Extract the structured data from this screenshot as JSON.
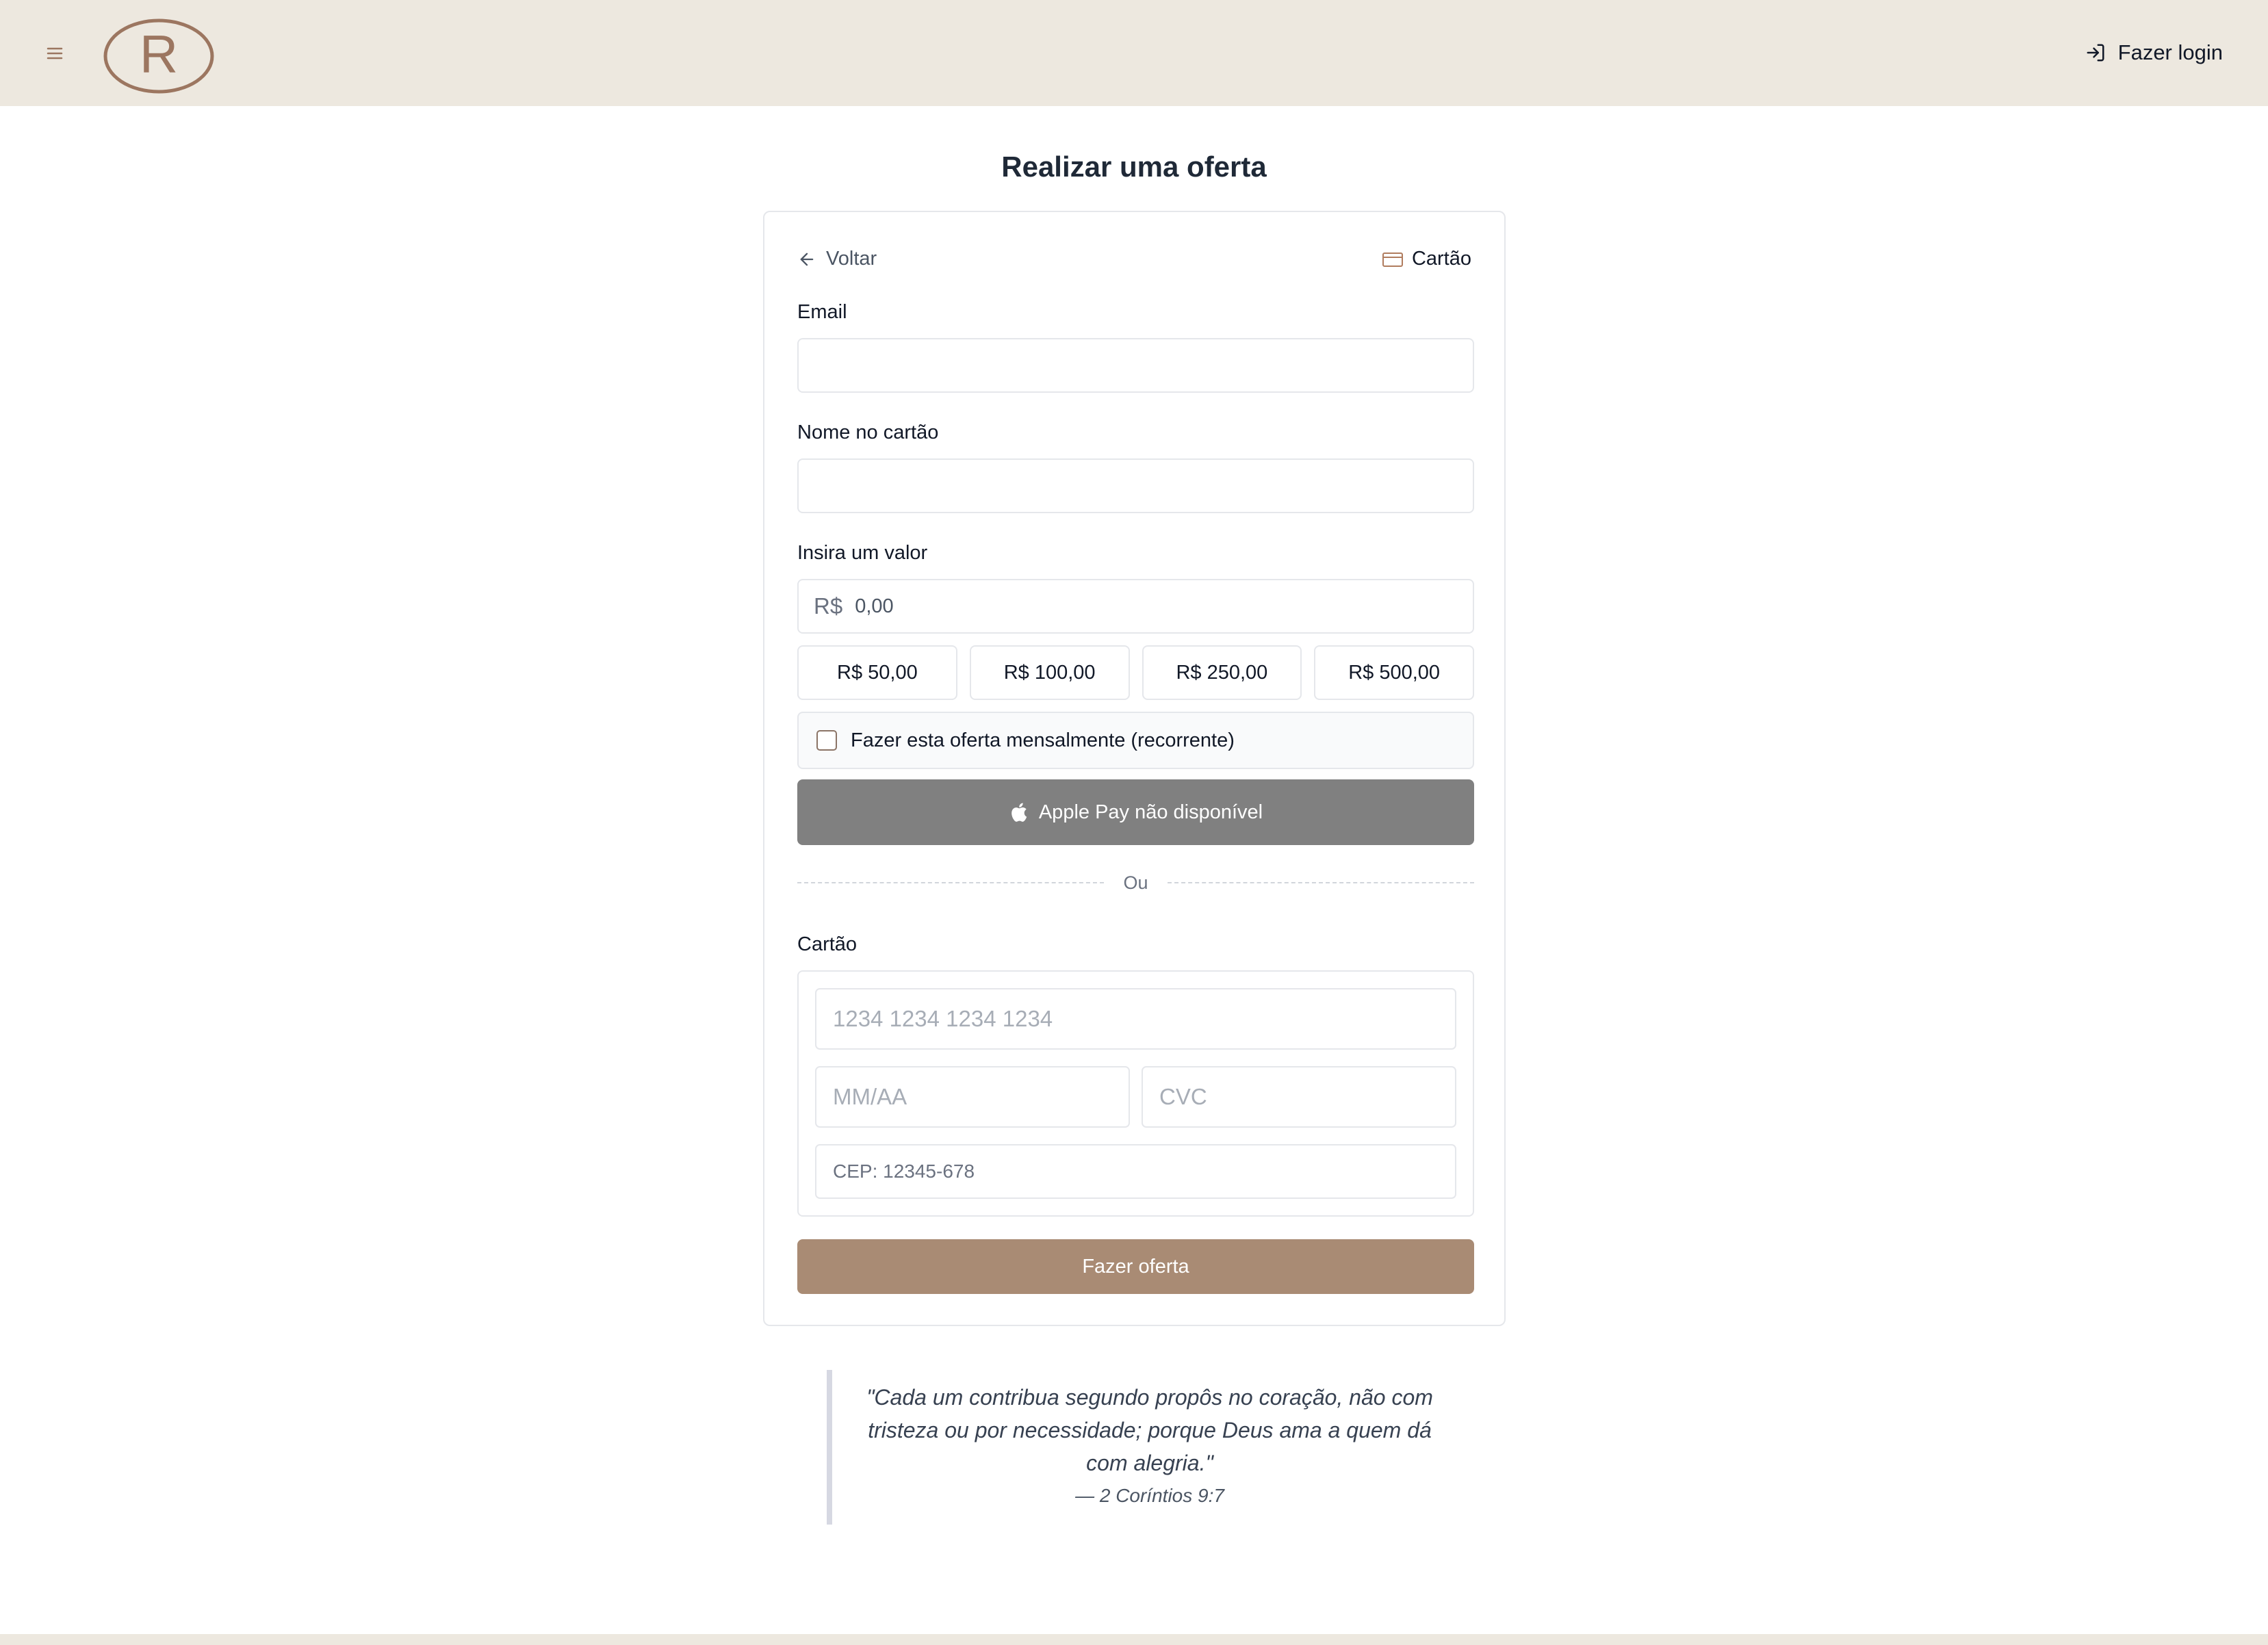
{
  "header": {
    "login_label": "Fazer login"
  },
  "logo": {
    "letter": "R"
  },
  "page_title": "Realizar uma oferta",
  "form": {
    "back_label": "Voltar",
    "method_label": "Cartão",
    "email_label": "Email",
    "email_value": "",
    "name_label": "Nome no cartão",
    "name_value": "",
    "amount_label": "Insira um valor",
    "amount_prefix": "R$",
    "amount_placeholder": "0,00",
    "presets": [
      "R$ 50,00",
      "R$ 100,00",
      "R$ 250,00",
      "R$ 500,00"
    ],
    "recurring_label": "Fazer esta oferta mensalmente (recorrente)",
    "recurring_checked": false,
    "apple_pay_label": "Apple Pay não disponível",
    "divider_label": "Ou",
    "card_section_label": "Cartão",
    "card_number_placeholder": "1234 1234 1234 1234",
    "expiry_placeholder": "MM/AA",
    "cvc_placeholder": "CVC",
    "zip_placeholder": "CEP: 12345-678",
    "submit_label": "Fazer oferta"
  },
  "quote": {
    "text": "\"Cada um contribua segundo propôs no coração, não com tristeza ou por necessidade; porque Deus ama a quem dá com alegria.\"",
    "reference": "— 2 Coríntios 9:7"
  },
  "colors": {
    "header_bg": "#ede8df",
    "brand": "#9c7660",
    "submit_bg": "#a98b74",
    "apple_pay_bg": "#808080"
  },
  "icons": {
    "menu": "menu-icon",
    "login": "login-icon",
    "back": "arrow-left-icon",
    "card": "credit-card-icon",
    "apple": "apple-icon"
  }
}
